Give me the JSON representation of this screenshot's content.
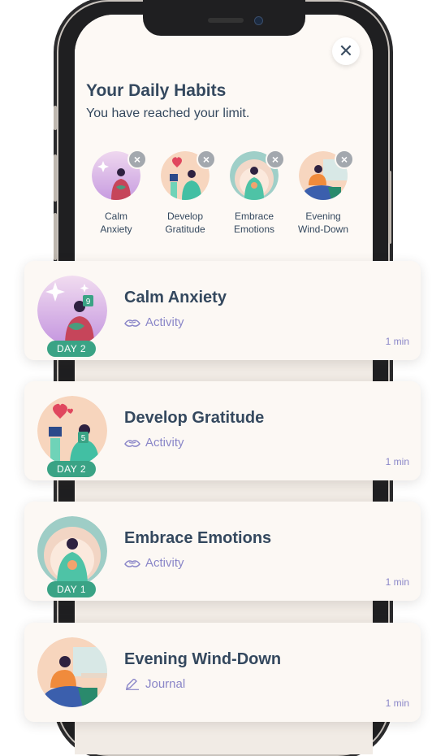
{
  "sheet": {
    "title": "Your Daily Habits",
    "subtitle": "You have reached your limit.",
    "close_icon": "close-icon"
  },
  "habits": [
    {
      "label": "Calm\nAnxiety",
      "icon": "calm-anxiety-illustration",
      "remove_icon": "remove-icon"
    },
    {
      "label": "Develop\nGratitude",
      "icon": "develop-gratitude-illustration",
      "remove_icon": "remove-icon"
    },
    {
      "label": "Embrace\nEmotions",
      "icon": "embrace-emotions-illustration",
      "remove_icon": "remove-icon"
    },
    {
      "label": "Evening\nWind-Down",
      "icon": "evening-wind-down-illustration",
      "remove_icon": "remove-icon"
    }
  ],
  "cards": [
    {
      "title": "Calm Anxiety",
      "type": "Activity",
      "type_icon": "hands-icon",
      "badge": "DAY 2",
      "duration": "1 min",
      "calendar_number": "9"
    },
    {
      "title": "Develop Gratitude",
      "type": "Activity",
      "type_icon": "hands-icon",
      "badge": "DAY 2",
      "duration": "1 min",
      "calendar_number": "5"
    },
    {
      "title": "Embrace Emotions",
      "type": "Activity",
      "type_icon": "hands-icon",
      "badge": "DAY 1",
      "duration": "1 min"
    },
    {
      "title": "Evening Wind-Down",
      "type": "Journal",
      "type_icon": "pencil-icon",
      "duration": "1 min"
    }
  ],
  "colors": {
    "text": "#34485e",
    "accent_purple": "#8a86c8",
    "badge_green": "#3aa385"
  }
}
